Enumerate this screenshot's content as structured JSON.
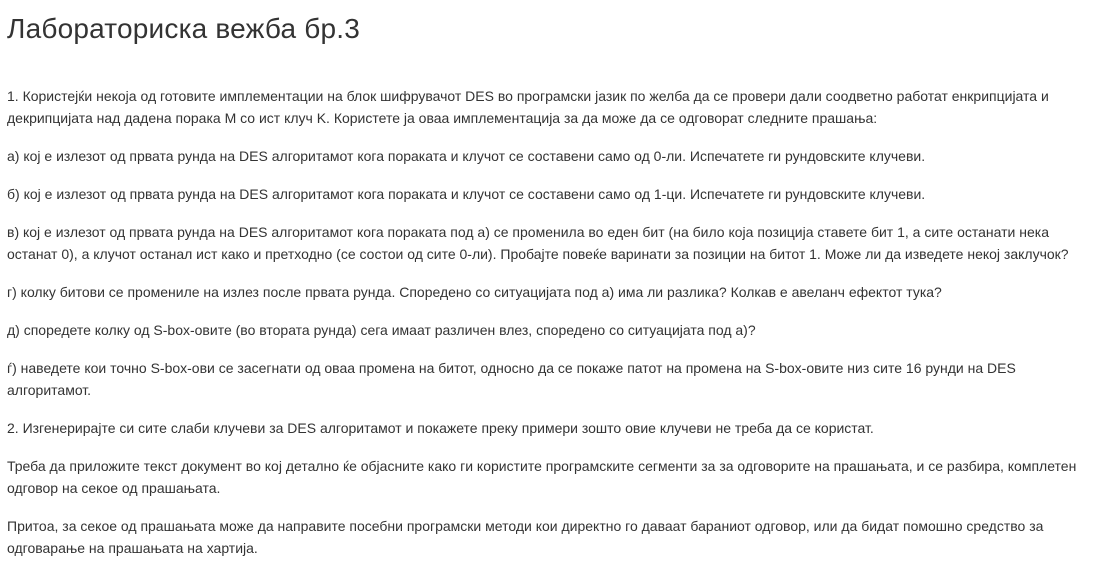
{
  "document": {
    "title": "Лабораториска вежба бр.3",
    "paragraphs": [
      "1. Користејќи некоја од готовите имплементации на блок шифрувачот DES во програмски јазик по желба да се провери дали соодветно работат енкрипцијата и декрипцијата над дадена порака M со ист клуч K. Користете ја оваа имплементација за да може да се одговорат следните прашања:",
      "а) кој е излезот од првата рунда на DES алгоритамот кога пораката и клучот се составени само од 0-ли. Испечатете ги рундовските клучеви.",
      "б) кој е излезот од првата рунда на DES алгоритамот кога пораката и клучот се составени само од 1-ци. Испечатете ги рундовските клучеви.",
      "в) кој е излезот од првата рунда на DES алгоритамот кога пораката под а) се променила во еден бит (на било која позиција ставете бит 1, а сите останати нека останат 0), а клучот останал ист како и претходно (се состои од сите 0-ли). Пробајте повеќе варинати за позиции на битот 1. Може ли да изведете некој заклучок?",
      "г) колку битови се промениле на излез после првата рунда. Споредено со ситуацијата под а) има ли разлика? Колкав е авеланч ефектот тука?",
      "д) споредете колку од S-box-овите (во втората рунда) сега имаат различен влез, споредено со ситуацијата под а)?",
      "ѓ) наведете кои точно S-box-ови се засегнати од оваа промена на битот, односно да се покаже патот на промена на S-box-овите низ сите 16 рунди на DES алгоритамот.",
      "2. Изгенерирајте си сите слаби клучеви за DES алгоритамот и покажете преку примери зошто овие клучеви не треба да се користат.",
      "Треба да приложите текст документ во кој детално ќе објасните како ги користите програмските сегменти за за одговорите на прашањата, и се разбира, комплетен одговор на секое од прашањата.",
      "Притоа, за секое од прашањата може да направите посебни програмски методи кои директно го даваат бараниот одговор, или да бидат помошно средство за одговарање на прашањата на хартија."
    ]
  }
}
